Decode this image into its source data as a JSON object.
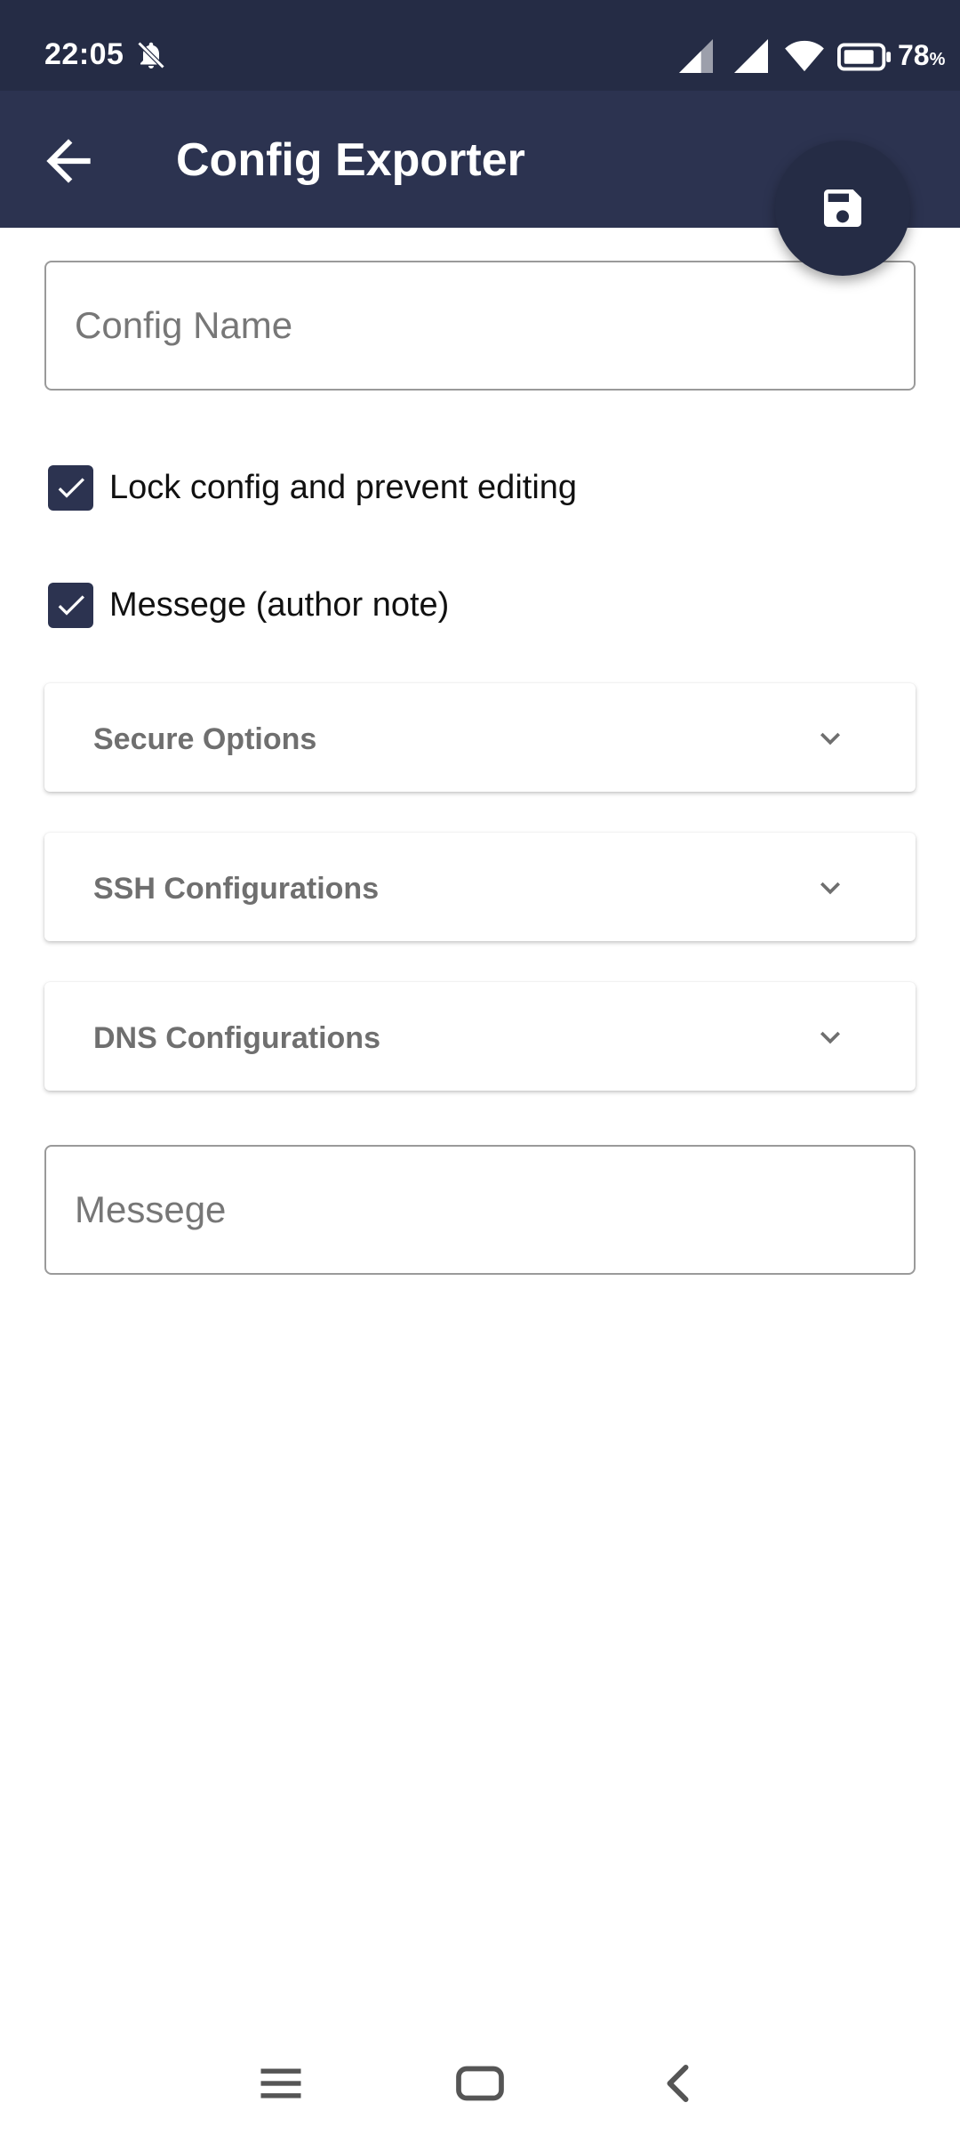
{
  "status_bar": {
    "time": "22:05",
    "battery_value": "78",
    "battery_unit": "%",
    "icons": [
      "bell-off-icon",
      "signal-icon",
      "signal-icon",
      "wifi-icon",
      "battery-icon"
    ]
  },
  "app_bar": {
    "title": "Config Exporter",
    "back_icon": "arrow-left-icon",
    "save_icon": "floppy-disk-icon"
  },
  "form": {
    "config_name_placeholder": "Config Name",
    "config_name_value": "",
    "lock_label": "Lock config and prevent editing",
    "lock_checked": true,
    "message_note_label": "Messege (author note)",
    "message_note_checked": true,
    "sections": [
      {
        "label": "Secure Options",
        "expanded": false
      },
      {
        "label": "SSH Configurations",
        "expanded": false
      },
      {
        "label": "DNS Configurations",
        "expanded": false
      }
    ],
    "message_placeholder": "Messege",
    "message_value": ""
  },
  "nav_bar": {
    "icons": [
      "menu-icon",
      "home-square-icon",
      "chevron-left-icon"
    ]
  },
  "colors": {
    "status_bar_bg": "#252c45",
    "app_bar_bg": "#2c3350",
    "checkbox_bg": "#2c3350",
    "section_label": "#6f6f6f"
  }
}
